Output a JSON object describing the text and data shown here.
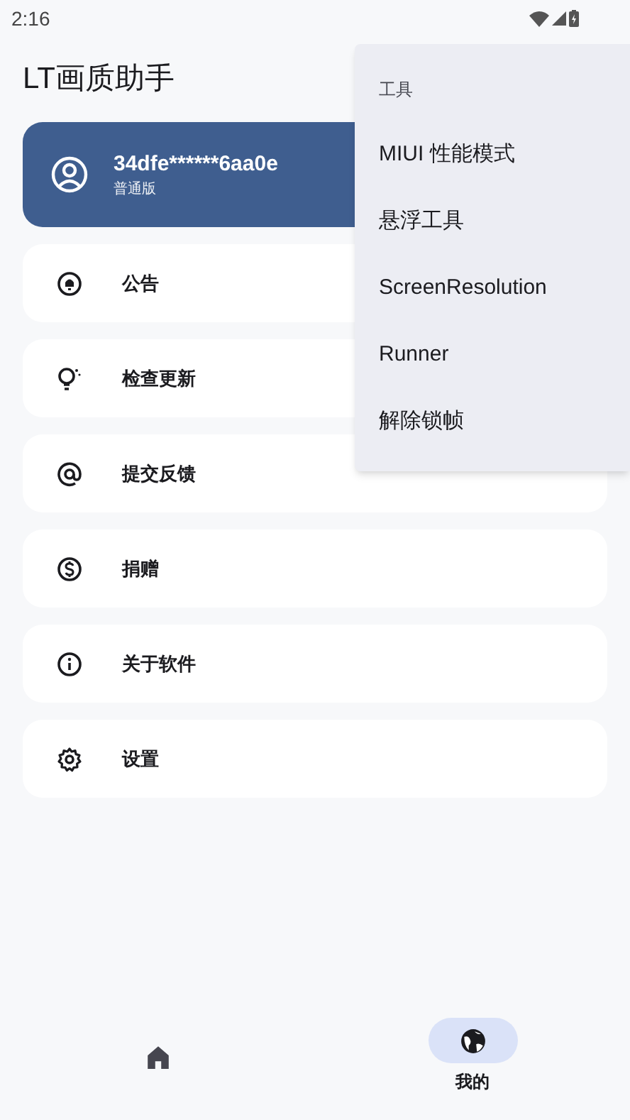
{
  "status_bar": {
    "time": "2:16"
  },
  "app_bar": {
    "title": "LT画质助手"
  },
  "account": {
    "id": "34dfe******6aa0e",
    "plan": "普通版"
  },
  "list": [
    {
      "label": "公告"
    },
    {
      "label": "检查更新"
    },
    {
      "label": "提交反馈"
    },
    {
      "label": "捐赠"
    },
    {
      "label": "关于软件"
    },
    {
      "label": "设置"
    }
  ],
  "menu": {
    "title": "工具",
    "items": [
      "MIUI 性能模式",
      "悬浮工具",
      "ScreenResolution",
      "Runner",
      "解除锁帧"
    ]
  },
  "nav": [
    {
      "selected": false
    },
    {
      "label": "我的",
      "selected": true
    }
  ]
}
